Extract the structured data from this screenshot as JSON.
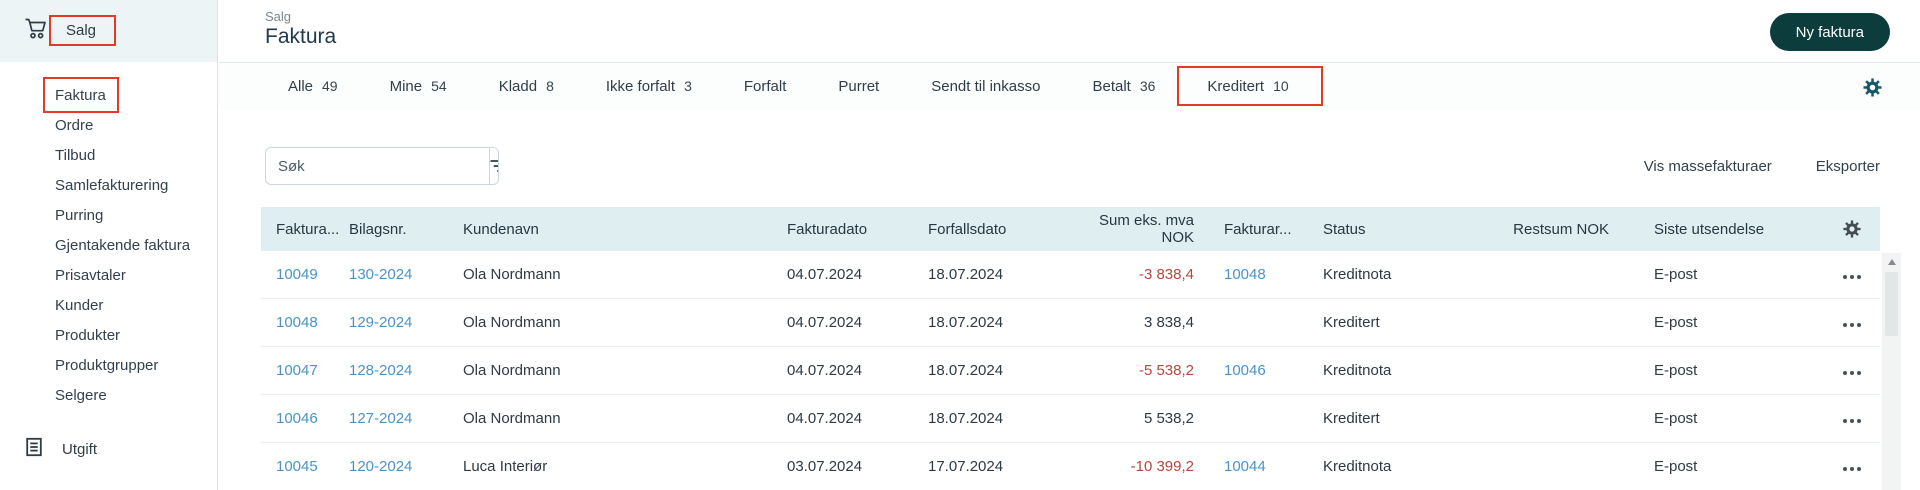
{
  "colors": {
    "annotation_red": "#e03b27",
    "primary_button_teal": "#0d3c3d",
    "link_blue": "#4a94c5",
    "negative_amount_red": "#b5473d",
    "table_header_bg": "#dfeef1",
    "sidebar_header_bg": "#edf4f6"
  },
  "sidebar": {
    "header_label": "Salg",
    "items": [
      "Faktura",
      "Ordre",
      "Tilbud",
      "Samlefakturering",
      "Purring",
      "Gjentakende faktura",
      "Prisavtaler",
      "Kunder",
      "Produkter",
      "Produktgrupper",
      "Selgere"
    ],
    "bottom_item": "Utgift"
  },
  "header": {
    "breadcrumb": "Salg",
    "title": "Faktura",
    "new_invoice_button": "Ny faktura"
  },
  "tabs": [
    {
      "label": "Alle",
      "count": "49"
    },
    {
      "label": "Mine",
      "count": "54"
    },
    {
      "label": "Kladd",
      "count": "8"
    },
    {
      "label": "Ikke forfalt",
      "count": "3"
    },
    {
      "label": "Forfalt",
      "count": ""
    },
    {
      "label": "Purret",
      "count": ""
    },
    {
      "label": "Sendt til inkasso",
      "count": ""
    },
    {
      "label": "Betalt",
      "count": "36"
    },
    {
      "label": "Kreditert",
      "count": "10"
    }
  ],
  "toolbar": {
    "search_placeholder": "Søk",
    "links": [
      "Vis massefakturaer",
      "Eksporter"
    ]
  },
  "table": {
    "headers": [
      "Faktura...",
      "Bilagsnr.",
      "Kundenavn",
      "Fakturadato",
      "Forfallsdato",
      "Sum eks. mva NOK",
      "Fakturar...",
      "Status",
      "Restsum NOK",
      "Siste utsendelse"
    ],
    "rows": [
      {
        "fakturanr": "10049",
        "bilagsnr": "130-2024",
        "kundenavn": "Ola Nordmann",
        "fakturadato": "04.07.2024",
        "forfallsdato": "18.07.2024",
        "sum": "-3 838,4",
        "fakturar": "10048",
        "status": "Kreditnota",
        "restsum": "",
        "siste_utsendelse": "E-post"
      },
      {
        "fakturanr": "10048",
        "bilagsnr": "129-2024",
        "kundenavn": "Ola Nordmann",
        "fakturadato": "04.07.2024",
        "forfallsdato": "18.07.2024",
        "sum": "3 838,4",
        "fakturar": "",
        "status": "Kreditert",
        "restsum": "",
        "siste_utsendelse": "E-post"
      },
      {
        "fakturanr": "10047",
        "bilagsnr": "128-2024",
        "kundenavn": "Ola Nordmann",
        "fakturadato": "04.07.2024",
        "forfallsdato": "18.07.2024",
        "sum": "-5 538,2",
        "fakturar": "10046",
        "status": "Kreditnota",
        "restsum": "",
        "siste_utsendelse": "E-post"
      },
      {
        "fakturanr": "10046",
        "bilagsnr": "127-2024",
        "kundenavn": "Ola Nordmann",
        "fakturadato": "04.07.2024",
        "forfallsdato": "18.07.2024",
        "sum": "5 538,2",
        "fakturar": "",
        "status": "Kreditert",
        "restsum": "",
        "siste_utsendelse": "E-post"
      },
      {
        "fakturanr": "10045",
        "bilagsnr": "120-2024",
        "kundenavn": "Luca Interiør",
        "fakturadato": "03.07.2024",
        "forfallsdato": "17.07.2024",
        "sum": "-10 399,2",
        "fakturar": "10044",
        "status": "Kreditnota",
        "restsum": "",
        "siste_utsendelse": "E-post"
      }
    ]
  }
}
